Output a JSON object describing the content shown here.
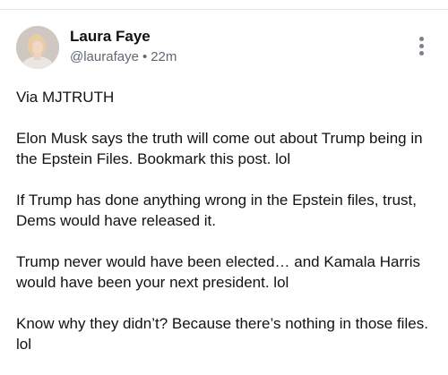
{
  "post": {
    "author": {
      "display_name": "Laura Faye",
      "handle": "@laurafaye",
      "separator": "•",
      "time_ago": "22m"
    },
    "paragraphs": [
      "Via MJTRUTH",
      "Elon Musk says the truth will come out about Trump being in the Epstein Files. Bookmark this post. lol",
      "If Trump has done anything wrong in the Epstein files, trust, Dems would have released it.",
      "Trump never would have been elected… and Kamala Harris would have been your next president. lol",
      "Know why they didn’t? Because there’s nothing in those files. lol"
    ]
  },
  "icons": {
    "more": "more-vertical-icon"
  }
}
